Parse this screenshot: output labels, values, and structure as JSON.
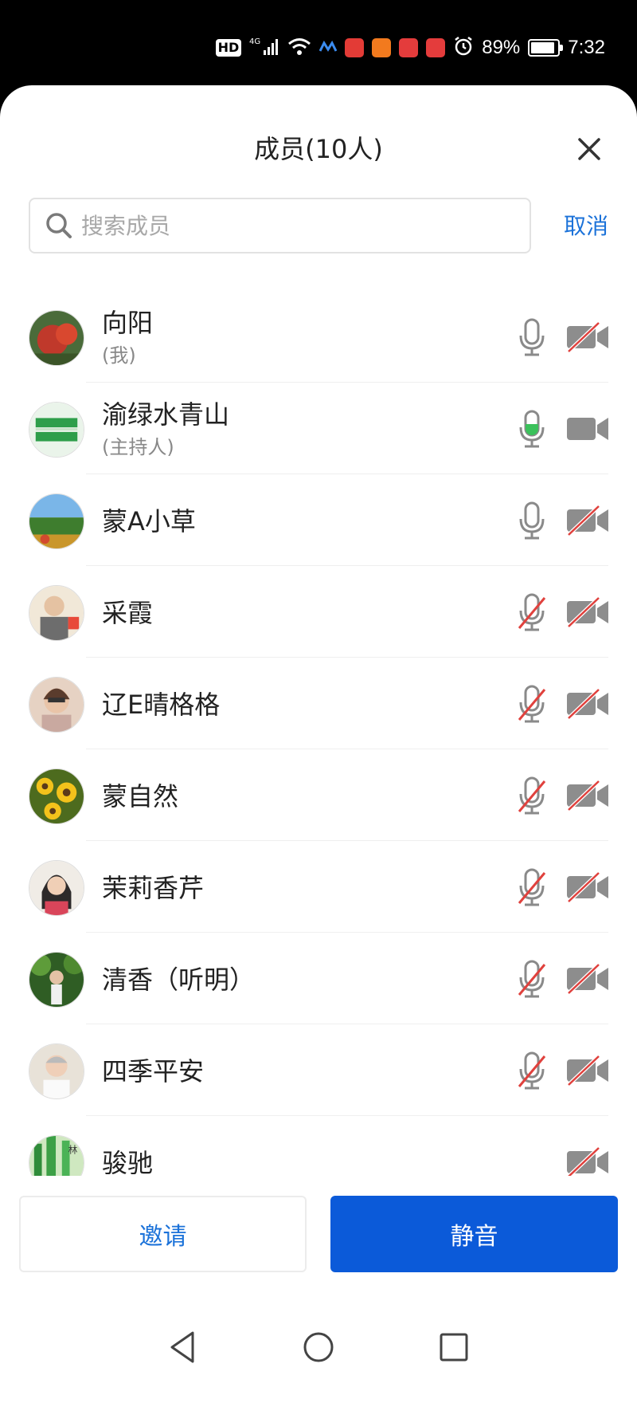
{
  "status_bar": {
    "network": "HD",
    "signal": "4G",
    "battery": "89%",
    "battery_level": 0.89,
    "time": "7:32"
  },
  "sheet": {
    "title": "成员(10人)",
    "close_icon": "close-icon"
  },
  "search": {
    "placeholder": "搜索成员",
    "value": "",
    "cancel_label": "取消"
  },
  "members": [
    {
      "name": "向阳",
      "role": "(我)",
      "mic": "on",
      "camera": "off"
    },
    {
      "name": "渝绿水青山",
      "role": "(主持人)",
      "mic": "speaking",
      "camera": "on"
    },
    {
      "name": "蒙A小草",
      "role": "",
      "mic": "on",
      "camera": "off"
    },
    {
      "name": "采霞",
      "role": "",
      "mic": "muted",
      "camera": "off"
    },
    {
      "name": "辽E晴格格",
      "role": "",
      "mic": "muted",
      "camera": "off"
    },
    {
      "name": "蒙自然",
      "role": "",
      "mic": "muted",
      "camera": "off"
    },
    {
      "name": "茉莉香芹",
      "role": "",
      "mic": "muted",
      "camera": "off"
    },
    {
      "name": "清香（听明）",
      "role": "",
      "mic": "muted",
      "camera": "off"
    },
    {
      "name": "四季平安",
      "role": "",
      "mic": "muted",
      "camera": "off"
    },
    {
      "name": "骏驰",
      "role": "",
      "mic": "none",
      "camera": "off"
    }
  ],
  "buttons": {
    "invite_label": "邀请",
    "mute_label": "静音"
  },
  "colors": {
    "accent": "#0b5ad9",
    "link": "#1b72d9",
    "icon_gray": "#8a8a8a",
    "mic_active": "#3bc15b",
    "disabled_slash": "#e0413d"
  },
  "navbar": {
    "icons": [
      "back-icon",
      "home-icon",
      "recents-icon"
    ]
  }
}
